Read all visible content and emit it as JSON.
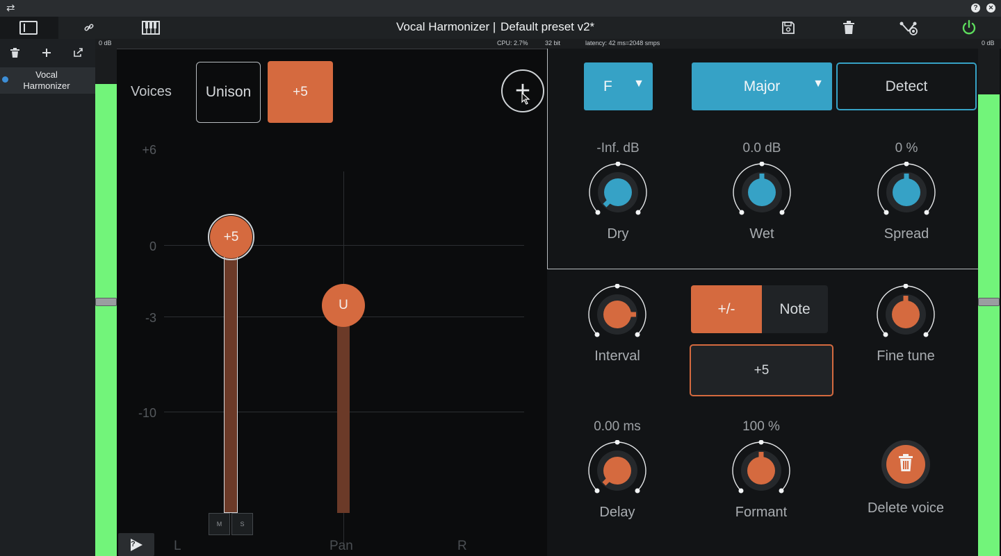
{
  "window": {
    "swap_icon": "⇄",
    "help_icon": "?",
    "close_icon": "✕"
  },
  "header": {
    "title": "Vocal Harmonizer |",
    "preset": "Default preset v2*",
    "accent": "#5ddd5d"
  },
  "infobar": {
    "left_db": "0 dB",
    "cpu": "CPU: 2.7%",
    "bits": "32 bit",
    "latency": "latency: 42 ms=2048 smps",
    "right_db": "0 dB"
  },
  "sidebar": {
    "plugin_name": "Vocal Harmonizer"
  },
  "meters": {
    "left_level": 0.93,
    "right_level": 0.91,
    "color": "#72f47a"
  },
  "voices": {
    "label": "Voices",
    "buttons": [
      "Unison",
      "+5"
    ],
    "selected": "+5",
    "add_label": "+"
  },
  "fader_chart": {
    "y_ticks": [
      "+6",
      "0",
      "-3",
      "-10"
    ],
    "x_labels": [
      "L",
      "Pan",
      "R"
    ],
    "voice_a_label": "+5",
    "voice_b_label": "U",
    "mute_label": "M",
    "solo_label": "S",
    "help_label": "?"
  },
  "key": {
    "root": "F",
    "scale": "Major",
    "detect": "Detect",
    "accent": "#36a2c6"
  },
  "mix": {
    "dry": {
      "value": "-Inf. dB",
      "label": "Dry"
    },
    "wet": {
      "value": "0.0 dB",
      "label": "Wet"
    },
    "spread": {
      "value": "0 %",
      "label": "Spread"
    }
  },
  "voice": {
    "interval_label": "Interval",
    "mode_buttons": [
      "+/-",
      "Note"
    ],
    "interval_value": "+5",
    "fine_tune_label": "Fine tune",
    "delay": {
      "value": "0.00 ms",
      "label": "Delay"
    },
    "formant": {
      "value": "100 %",
      "label": "Formant"
    },
    "delete_label": "Delete voice",
    "accent": "#d56a3f"
  }
}
